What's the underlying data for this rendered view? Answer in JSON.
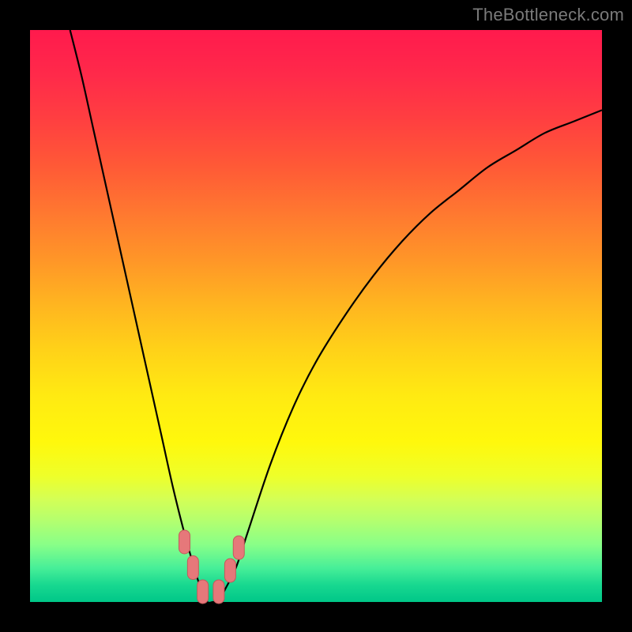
{
  "watermark": "TheBottleneck.com",
  "chart_data": {
    "type": "line",
    "title": "",
    "xlabel": "",
    "ylabel": "",
    "xlim": [
      0,
      100
    ],
    "ylim": [
      0,
      100
    ],
    "series": [
      {
        "name": "bottleneck-curve",
        "x": [
          7,
          9,
          11,
          13,
          15,
          17,
          19,
          21,
          23,
          25,
          27,
          29,
          30,
          31,
          32,
          33,
          34,
          36,
          38,
          42,
          46,
          50,
          55,
          60,
          65,
          70,
          75,
          80,
          85,
          90,
          95,
          100
        ],
        "y": [
          100,
          92,
          83,
          74,
          65,
          56,
          47,
          38,
          29,
          20,
          12,
          5,
          2,
          0,
          0,
          0,
          2,
          6,
          12,
          24,
          34,
          42,
          50,
          57,
          63,
          68,
          72,
          76,
          79,
          82,
          84,
          86
        ]
      }
    ],
    "markers": [
      {
        "name": "marker-left-upper",
        "x": 27.0,
        "y": 10.5
      },
      {
        "name": "marker-left-lower",
        "x": 28.5,
        "y": 6.0
      },
      {
        "name": "marker-bottom-left",
        "x": 30.2,
        "y": 1.8
      },
      {
        "name": "marker-bottom-right",
        "x": 33.0,
        "y": 1.8
      },
      {
        "name": "marker-right-lower",
        "x": 35.0,
        "y": 5.5
      },
      {
        "name": "marker-right-upper",
        "x": 36.5,
        "y": 9.5
      }
    ],
    "colors": {
      "curve": "#000000",
      "marker_fill": "#e6787a",
      "marker_stroke": "#c45a5c"
    }
  }
}
